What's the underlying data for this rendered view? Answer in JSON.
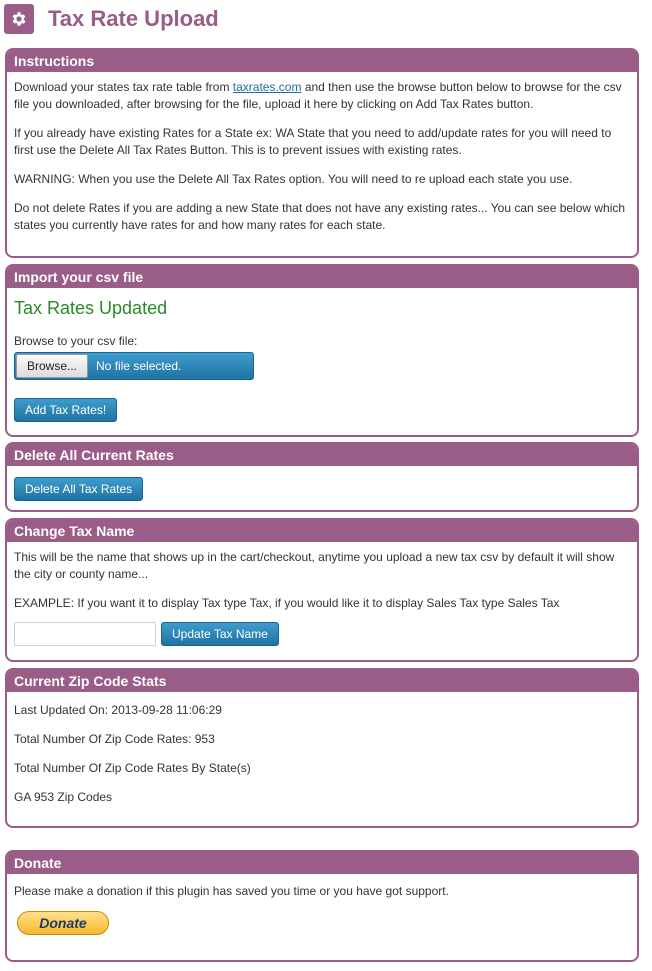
{
  "header": {
    "icon": "gear-icon",
    "title": "Tax Rate Upload"
  },
  "instructions": {
    "title": "Instructions",
    "p1_before": "Download your states tax rate table from ",
    "p1_link": "taxrates.com",
    "p1_after": " and then use the browse button below to browse for the csv file you downloaded, after browsing for the file, upload it here by clicking on Add Tax Rates button.",
    "p2": "If you already have existing Rates for a State ex: WA State that you need to add/update rates for you will need to first use the Delete All Tax Rates Button. This is to prevent issues with existing rates.",
    "p3": "WARNING: When you use the Delete All Tax Rates option. You will need to re upload each state you use.",
    "p4": "Do not delete Rates if you are adding a new State that does not have any existing rates... You can see below which states you currently have rates for and how many rates for each state."
  },
  "import": {
    "title": "Import your csv file",
    "success": "Tax Rates Updated",
    "browse_label": "Browse to your csv file:",
    "browse_button": "Browse...",
    "file_status": "No file selected.",
    "add_button": "Add Tax Rates!"
  },
  "delete": {
    "title": "Delete All Current Rates",
    "button": "Delete All Tax Rates"
  },
  "change_name": {
    "title": "Change Tax Name",
    "p1": "This will be the name that shows up in the cart/checkout, anytime you upload a new tax csv by default it will show the city or county name...",
    "p2": "EXAMPLE: If you want it to display Tax type Tax, if you would like it to display Sales Tax type Sales Tax",
    "input_value": "",
    "button": "Update Tax Name"
  },
  "stats": {
    "title": "Current Zip Code Stats",
    "last_updated": "Last Updated On: 2013-09-28 11:06:29",
    "total": "Total Number Of Zip Code Rates: 953",
    "by_state_label": "Total Number Of Zip Code Rates By State(s)",
    "states": [
      "GA 953 Zip Codes"
    ]
  },
  "donate": {
    "title": "Donate",
    "text": "Please make a donation if this plugin has saved you time or you have got support.",
    "button": "Donate"
  },
  "colors": {
    "accent": "#9a5d87",
    "button": "#2a86b8",
    "success": "#2a8a2a",
    "link": "#1e6f9f"
  }
}
